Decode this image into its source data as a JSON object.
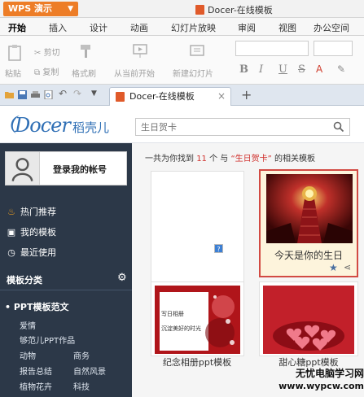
{
  "titlebar": {
    "app_menu_label": "WPS 演示",
    "window_title": "Docer-在线模板"
  },
  "ribbon": {
    "tabs": [
      "开始",
      "插入",
      "设计",
      "动画",
      "幻灯片放映",
      "审阅",
      "视图",
      "办公空间"
    ]
  },
  "toolbar": {
    "paste": "粘贴",
    "cut": "剪切",
    "copy": "复制",
    "format_painter": "格式刷",
    "from_current": "从当前开始",
    "new_slide": "新建幻灯片",
    "bold": "B",
    "italic": "I",
    "underline": "U",
    "strike": "S"
  },
  "doc_tab": {
    "label": "Docer-在线模板",
    "close": "×",
    "new": "+"
  },
  "docer": {
    "logo_text": "Docer",
    "logo_cn": "稻壳儿",
    "brand_color": "#2f6fb5",
    "search_placeholder": "生日贺卡"
  },
  "sidebar": {
    "login_label": "登录我的帐号",
    "items": [
      {
        "icon": "flame-icon",
        "label": "热门推荐"
      },
      {
        "icon": "template-icon",
        "label": "我的模板"
      },
      {
        "icon": "clock-icon",
        "label": "最近使用"
      }
    ],
    "section_title": "模板分类",
    "category_title": "PPT模板范文",
    "categories": [
      "爱情",
      "够范儿PPT作品",
      "动物",
      "商务",
      "报告总结",
      "自然风景",
      "植物花卉",
      "科技"
    ]
  },
  "results": {
    "prefix": "一共为你找到",
    "count": "11",
    "mid": "个 与",
    "keyword": "“生日贺卡”",
    "suffix": "的相关模板",
    "highlight_color": "#d0312d"
  },
  "cards": [
    {
      "label": "",
      "selected": false
    },
    {
      "label": "今天是你的生日",
      "selected": true
    },
    {
      "label": "纪念相册ppt模板",
      "selected": false
    },
    {
      "label": "甜心糖ppt模板",
      "selected": false
    }
  ],
  "card1_thumb_text": [
    "写日相册",
    "沉淀美好的时光"
  ],
  "watermark": {
    "line1": "无忧电脑学习网",
    "line2": "www.wypcw.com"
  }
}
